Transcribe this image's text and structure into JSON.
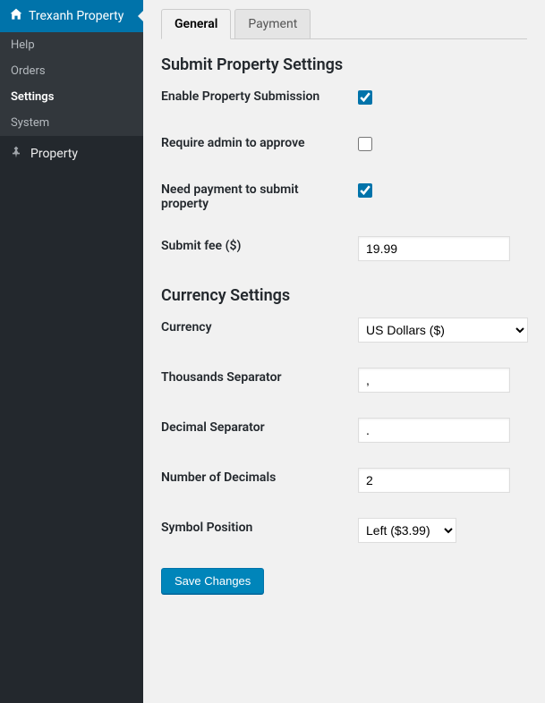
{
  "sidebar": {
    "header": "Trexanh Property",
    "submenu": [
      {
        "label": "Help",
        "current": false
      },
      {
        "label": "Orders",
        "current": false
      },
      {
        "label": "Settings",
        "current": true
      },
      {
        "label": "System",
        "current": false
      }
    ],
    "menu": [
      {
        "label": "Property",
        "icon": "pin"
      }
    ]
  },
  "tabs": [
    {
      "label": "General",
      "active": true
    },
    {
      "label": "Payment",
      "active": false
    }
  ],
  "sections": {
    "submit": {
      "heading": "Submit Property Settings",
      "enable_label": "Enable Property Submission",
      "enable_value": true,
      "approve_label": "Require admin to approve",
      "approve_value": false,
      "payment_label": "Need payment to submit property",
      "payment_value": true,
      "fee_label": "Submit fee ($)",
      "fee_value": "19.99"
    },
    "currency": {
      "heading": "Currency Settings",
      "currency_label": "Currency",
      "currency_value": "US Dollars ($)",
      "thousand_label": "Thousands Separator",
      "thousand_value": ",",
      "decimal_label": "Decimal Separator",
      "decimal_value": ".",
      "num_decimals_label": "Number of Decimals",
      "num_decimals_value": "2",
      "symbol_label": "Symbol Position",
      "symbol_value": "Left ($3.99)"
    }
  },
  "buttons": {
    "save": "Save Changes"
  }
}
